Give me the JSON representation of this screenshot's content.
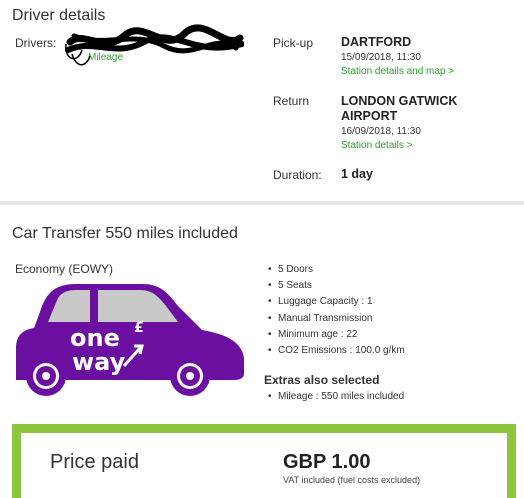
{
  "driver": {
    "section_title": "Driver details",
    "drivers_label": "Drivers:",
    "name_link_partial": "Mileage"
  },
  "trip": {
    "pickup_label": "Pick-up",
    "pickup_location": "DARTFORD",
    "pickup_datetime": "15/09/2018, 11:30",
    "pickup_link": "Station details and map >",
    "return_label": "Return",
    "return_location_line1": "LONDON GATWICK",
    "return_location_line2": "AIRPORT",
    "return_datetime": "16/09/2018, 11:30",
    "return_link": "Station details >",
    "duration_label": "Duration:",
    "duration_value": "1  day"
  },
  "car": {
    "section_title": "Car Transfer 550 miles included",
    "category": "Economy  (EOWY)",
    "brand_line1": "one",
    "brand_line2": "way",
    "brand_symbol": "£",
    "features": [
      "5 Doors",
      "5 Seats",
      "Luggage Capacity : 1",
      "Manual Transmission",
      "Minimum age : 22",
      "CO2 Emissions : 100.0 g/km"
    ],
    "extras_title": "Extras also selected",
    "extras": [
      "Mileage : 550 miles included"
    ]
  },
  "price": {
    "label": "Price paid",
    "amount": "GBP 1.00",
    "vat_note": "VAT included (fuel costs excluded)"
  },
  "colors": {
    "accent_green": "#8cc63f",
    "link_green": "#2a9b2a",
    "car_purple": "#6a0fa0"
  }
}
